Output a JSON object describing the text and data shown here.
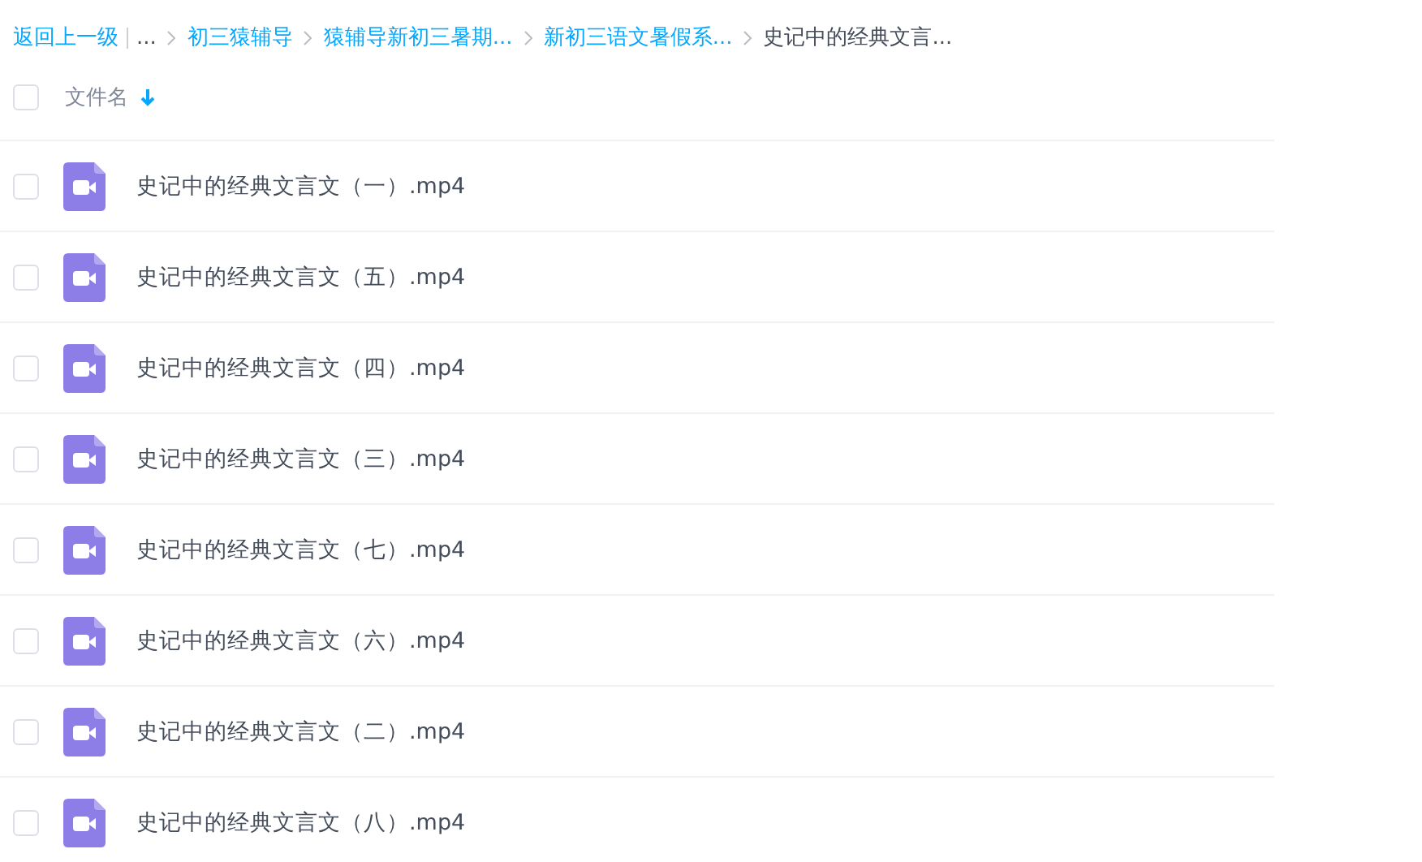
{
  "breadcrumb": {
    "back": "返回上一级",
    "ellipsis": "...",
    "items": [
      {
        "label": "初三猿辅导",
        "current": false
      },
      {
        "label": "猿辅导新初三暑期...",
        "current": false
      },
      {
        "label": "新初三语文暑假系...",
        "current": false
      },
      {
        "label": "史记中的经典文言...",
        "current": true
      }
    ]
  },
  "header": {
    "label": "文件名",
    "checked": false
  },
  "files": [
    {
      "name": "史记中的经典文言文（一）.mp4",
      "checked": false
    },
    {
      "name": "史记中的经典文言文（五）.mp4",
      "checked": false
    },
    {
      "name": "史记中的经典文言文（四）.mp4",
      "checked": false
    },
    {
      "name": "史记中的经典文言文（三）.mp4",
      "checked": false
    },
    {
      "name": "史记中的经典文言文（七）.mp4",
      "checked": false
    },
    {
      "name": "史记中的经典文言文（六）.mp4",
      "checked": false
    },
    {
      "name": "史记中的经典文言文（二）.mp4",
      "checked": false
    },
    {
      "name": "史记中的经典文言文（八）.mp4",
      "checked": false
    }
  ]
}
